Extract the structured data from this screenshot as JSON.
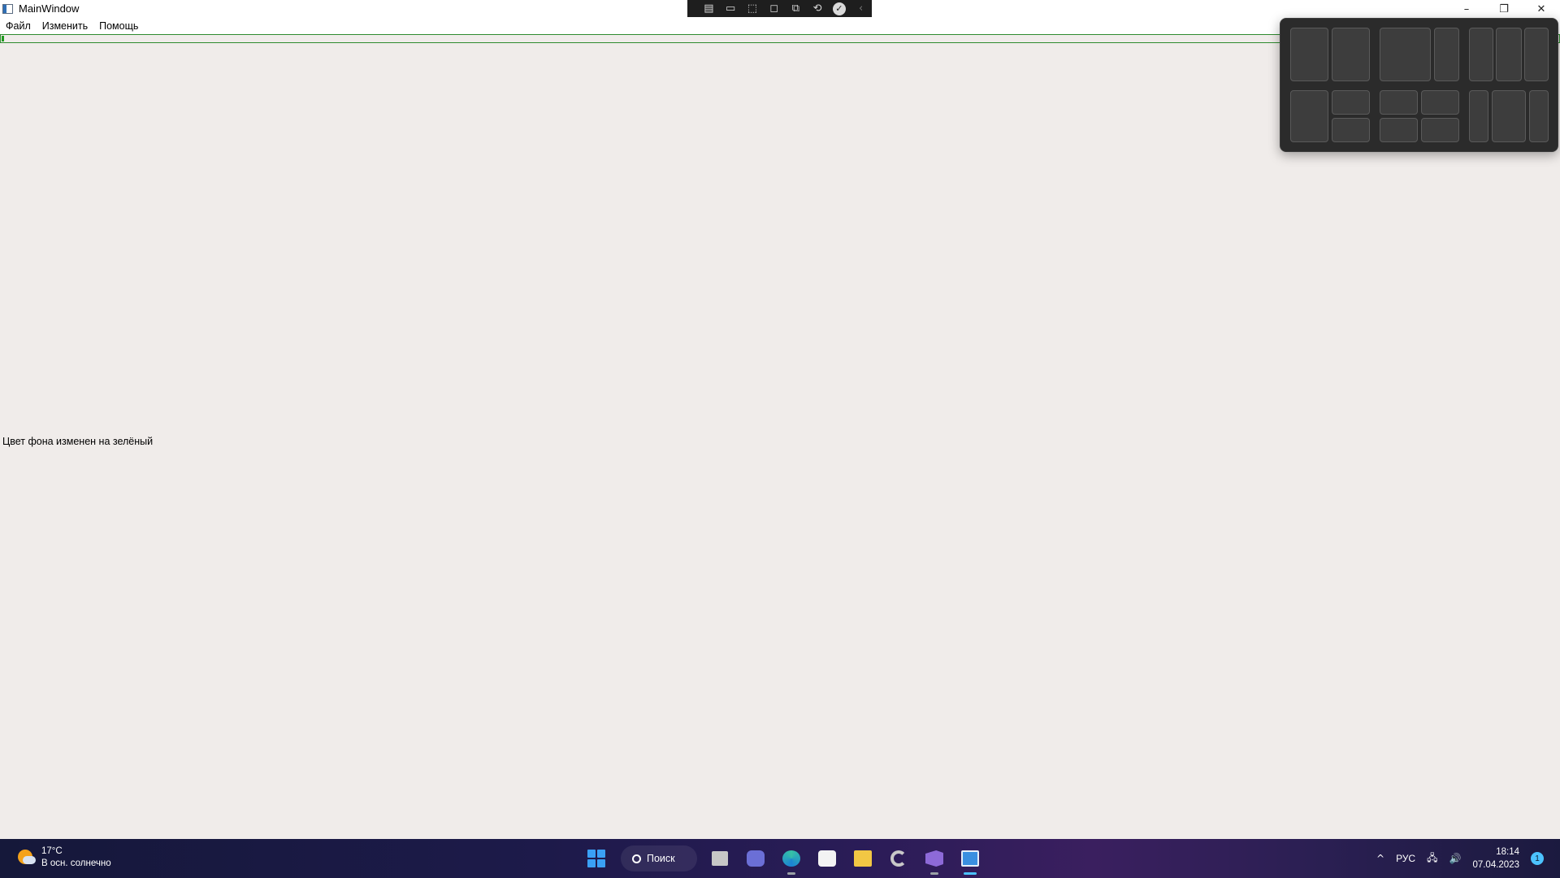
{
  "window": {
    "title": "MainWindow",
    "controls": {
      "minimize": "–",
      "maximize": "❐",
      "close": "✕"
    }
  },
  "debug_toolbar": {
    "buttons": [
      {
        "name": "live-visual-tree-icon",
        "glyph": "▤"
      },
      {
        "name": "record-icon",
        "glyph": "▭"
      },
      {
        "name": "select-element-icon",
        "glyph": "⬚"
      },
      {
        "name": "display-layout-adorners-icon",
        "glyph": "◻"
      },
      {
        "name": "track-focused-element-icon",
        "glyph": "⧉"
      },
      {
        "name": "hot-reload-icon",
        "glyph": "⟲"
      }
    ],
    "check": "✓",
    "collapse": "‹"
  },
  "menu": {
    "items": [
      "Файл",
      "Изменить",
      "Помощь"
    ]
  },
  "main": {
    "status_message": "Цвет фона изменен на зелёный"
  },
  "taskbar": {
    "weather": {
      "temperature": "17°C",
      "description": "В осн. солнечно"
    },
    "search_label": "Поиск",
    "tray": {
      "chevron": "^",
      "language": "РУС",
      "network": "🖧",
      "volume": "🔊",
      "time": "18:14",
      "date": "07.04.2023",
      "notification_count": "1"
    },
    "accent": "#4cc2ff"
  }
}
